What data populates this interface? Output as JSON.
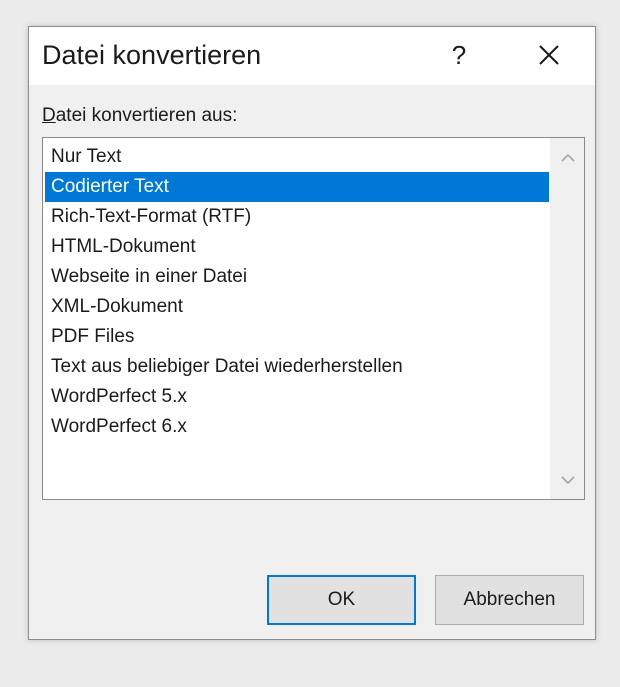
{
  "dialog": {
    "title": "Datei konvertieren",
    "help_label": "?",
    "close_icon": "close-icon"
  },
  "list": {
    "label_mnemonic": "D",
    "label_rest": "atei konvertieren aus:",
    "selected_index": 1,
    "items": [
      "Nur Text",
      "Codierter Text",
      "Rich-Text-Format (RTF)",
      "HTML-Dokument",
      "Webseite in einer Datei",
      "XML-Dokument",
      "PDF Files",
      "Text aus beliebiger Datei wiederherstellen",
      "WordPerfect 5.x",
      "WordPerfect 6.x"
    ]
  },
  "buttons": {
    "ok_label": "OK",
    "cancel_label": "Abbrechen"
  },
  "colors": {
    "selection": "#0078d7",
    "dialog_bg": "#f0f0f0",
    "titlebar_bg": "#ffffff"
  }
}
